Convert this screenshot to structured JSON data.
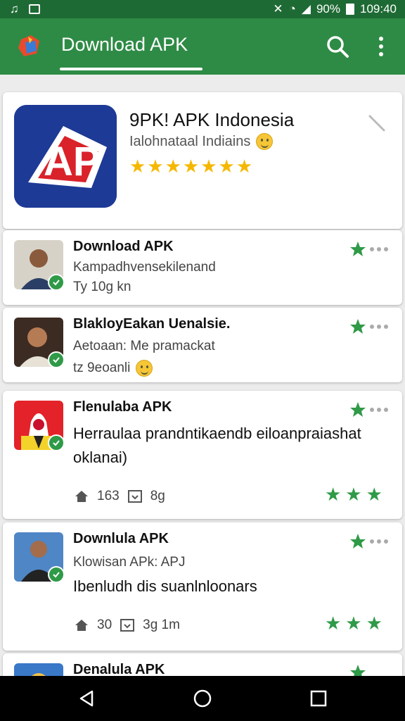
{
  "status_bar": {
    "battery": "90%",
    "time": "109:40"
  },
  "app_bar": {
    "title": "Download APK"
  },
  "hero": {
    "title": "9PK! APK Indonesia",
    "subtitle": "Ialohnataal Indiains",
    "rating_stars": "★★★★★★★",
    "icon_text": "AP"
  },
  "items": [
    {
      "title": "Download APK",
      "line1": "Kampadhvensekilenand",
      "line2": "Ty 10g kn"
    },
    {
      "title": "BlakloyEakan Uenalsie.",
      "line1": "Aetoaan: Me pramackat",
      "line2": "tz 9eoanli"
    },
    {
      "title": "Flenulaba APK",
      "line1": "Herraulaa prandntikaendb eiloanpraiashat",
      "line1b": "oklanai)",
      "meta_count": "163",
      "meta_size": "8g",
      "stars": "★★★"
    },
    {
      "title": "Downlula APK",
      "line1": "Klowisan APk: APJ",
      "line2": "Ibenludh dis suanlnloonars",
      "meta_count": "30",
      "meta_size": "3g 1m",
      "stars": "★★★"
    },
    {
      "title": "Denalula APK"
    }
  ],
  "colors": {
    "brand_green": "#2e8b45",
    "status_green": "#1e6a34",
    "star_gold": "#f5b800",
    "star_green": "#2f9a47"
  }
}
